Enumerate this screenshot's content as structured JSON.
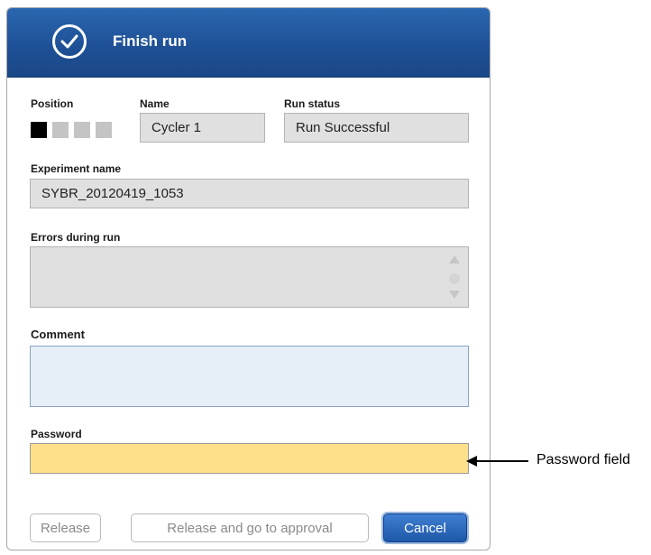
{
  "dialog": {
    "title": "Finish run",
    "icon": "check-circle-icon"
  },
  "position": {
    "label": "Position",
    "slots": [
      {
        "state": "active"
      },
      {
        "state": "inactive"
      },
      {
        "state": "inactive"
      },
      {
        "state": "inactive"
      }
    ]
  },
  "name": {
    "label": "Name",
    "value": "Cycler 1"
  },
  "run_status": {
    "label": "Run status",
    "value": "Run Successful"
  },
  "experiment_name": {
    "label": "Experiment name",
    "value": "SYBR_20120419_1053"
  },
  "errors_during_run": {
    "label": "Errors during run",
    "value": ""
  },
  "comment": {
    "label": "Comment",
    "value": ""
  },
  "password": {
    "label": "Password",
    "value": ""
  },
  "buttons": {
    "release": "Release",
    "release_and_approval": "Release and go to approval",
    "cancel": "Cancel"
  },
  "annotation": {
    "text": "Password field"
  },
  "colors": {
    "titlebar": "#1e4f95",
    "readonly_field": "#e0e0e0",
    "comment_field": "#e6eef8",
    "password_field": "#ffe08a",
    "primary_button": "#1e57a8"
  }
}
